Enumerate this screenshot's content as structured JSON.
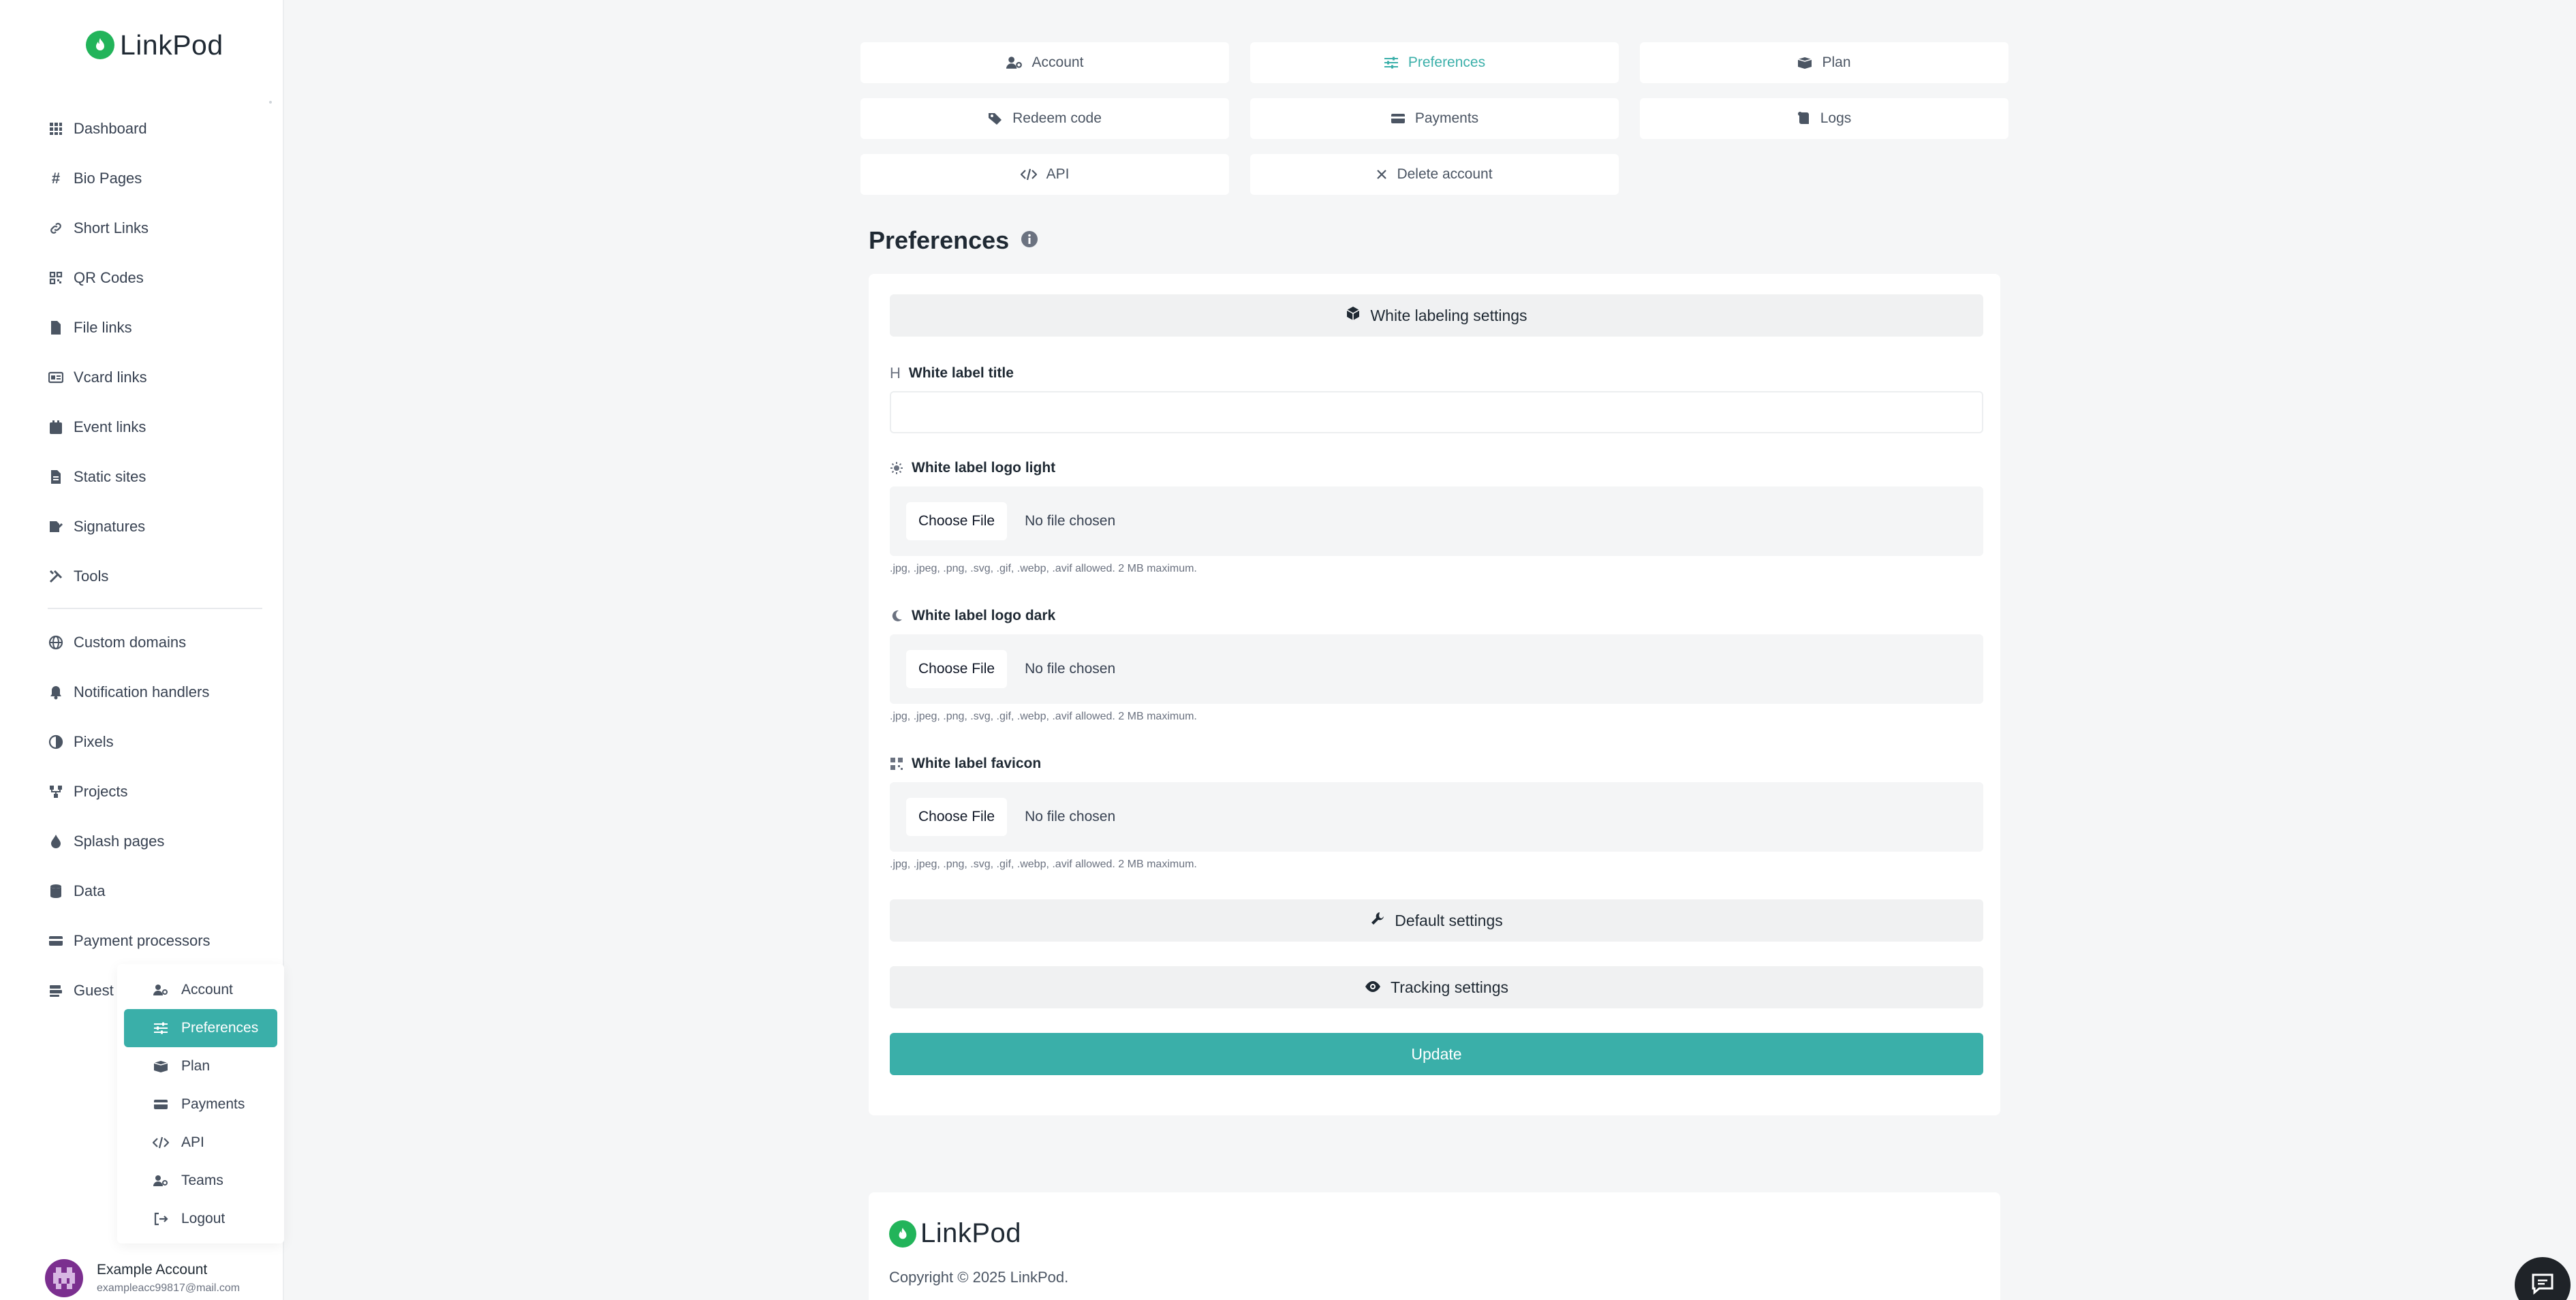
{
  "brand": {
    "name": "LinkPod",
    "color": "#22b45a"
  },
  "sidebar": {
    "items": [
      {
        "label": "Dashboard",
        "icon": "grid-icon"
      },
      {
        "label": "Bio Pages",
        "icon": "hash-icon"
      },
      {
        "label": "Short Links",
        "icon": "link-icon"
      },
      {
        "label": "QR Codes",
        "icon": "qrcode-icon"
      },
      {
        "label": "File links",
        "icon": "file-icon"
      },
      {
        "label": "Vcard links",
        "icon": "id-card-icon"
      },
      {
        "label": "Event links",
        "icon": "calendar-icon"
      },
      {
        "label": "Static sites",
        "icon": "document-icon"
      },
      {
        "label": "Signatures",
        "icon": "signature-icon"
      },
      {
        "label": "Tools",
        "icon": "tools-icon"
      }
    ],
    "items2": [
      {
        "label": "Custom domains",
        "icon": "globe-icon"
      },
      {
        "label": "Notification handlers",
        "icon": "bell-icon"
      },
      {
        "label": "Pixels",
        "icon": "adjust-icon"
      },
      {
        "label": "Projects",
        "icon": "project-icon"
      },
      {
        "label": "Splash pages",
        "icon": "droplet-icon"
      },
      {
        "label": "Data",
        "icon": "database-icon"
      },
      {
        "label": "Payment processors",
        "icon": "credit-card-icon"
      },
      {
        "label": "Guest",
        "icon": "layers-icon"
      }
    ]
  },
  "user_menu": {
    "items": [
      {
        "label": "Account",
        "icon": "user-cog-icon"
      },
      {
        "label": "Preferences",
        "icon": "sliders-icon",
        "active": true
      },
      {
        "label": "Plan",
        "icon": "box-icon"
      },
      {
        "label": "Payments",
        "icon": "credit-card-icon"
      },
      {
        "label": "API",
        "icon": "code-icon"
      },
      {
        "label": "Teams",
        "icon": "user-cog-icon"
      },
      {
        "label": "Logout",
        "icon": "logout-icon"
      }
    ]
  },
  "account": {
    "name": "Example Account",
    "email": "exampleacc99817@mail.com"
  },
  "tabs": [
    {
      "label": "Account",
      "icon": "user-cog-icon"
    },
    {
      "label": "Preferences",
      "icon": "sliders-icon",
      "active": true
    },
    {
      "label": "Plan",
      "icon": "box-icon"
    },
    {
      "label": "Redeem code",
      "icon": "tags-icon"
    },
    {
      "label": "Payments",
      "icon": "credit-card-icon"
    },
    {
      "label": "Logs",
      "icon": "scroll-icon"
    },
    {
      "label": "API",
      "icon": "code-icon"
    },
    {
      "label": "Delete account",
      "icon": "close-icon"
    }
  ],
  "page": {
    "title": "Preferences"
  },
  "form": {
    "white_labeling": "White labeling settings",
    "title_label": "White label title",
    "title_value": "",
    "logo_light_label": "White label logo light",
    "logo_dark_label": "White label logo dark",
    "favicon_label": "White label favicon",
    "choose_file": "Choose File",
    "no_file": "No file chosen",
    "help": ".jpg, .jpeg, .png, .svg, .gif, .webp, .avif allowed. 2 MB maximum.",
    "default_settings": "Default settings",
    "tracking_settings": "Tracking settings",
    "update": "Update"
  },
  "footer": {
    "brand": "LinkPod",
    "copyright": "Copyright © 2025 LinkPod."
  },
  "colors": {
    "accent": "#3aafa9",
    "background": "#f5f6f7"
  }
}
